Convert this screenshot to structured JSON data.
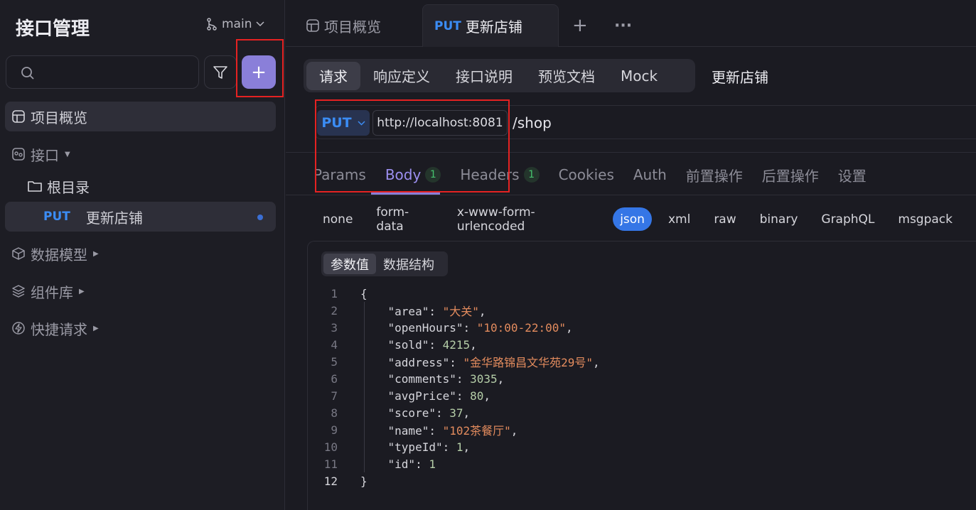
{
  "sidebar": {
    "title": "接口管理",
    "branch": "main",
    "add_label": "+",
    "overview": "项目概览",
    "interfaces": "接口",
    "root_dir": "根目录",
    "endpoint_method": "PUT",
    "endpoint_name": "更新店铺",
    "data_models": "数据模型",
    "components": "组件库",
    "quick_requests": "快捷请求"
  },
  "tabs": {
    "overview": "项目概览",
    "active_method": "PUT",
    "active_name": "更新店铺",
    "add": "+",
    "more": "···"
  },
  "subtabs": [
    "请求",
    "响应定义",
    "接口说明",
    "预览文档",
    "Mock"
  ],
  "api_name": "更新店铺",
  "url": {
    "method": "PUT",
    "base": "http://localhost:8081",
    "path": "/shop"
  },
  "request_tabs": {
    "params": "Params",
    "body": "Body",
    "body_count": "1",
    "headers": "Headers",
    "headers_count": "1",
    "cookies": "Cookies",
    "auth": "Auth",
    "pre": "前置操作",
    "post": "后置操作",
    "settings": "设置"
  },
  "body_types": [
    "none",
    "form-data",
    "x-www-form-urlencoded",
    "json",
    "xml",
    "raw",
    "binary",
    "GraphQL",
    "msgpack"
  ],
  "body_types_active": "json",
  "view_switch": [
    "参数值",
    "数据结构"
  ],
  "code": {
    "open": "{",
    "close": "}",
    "fields": [
      {
        "key": "\"area\"",
        "value": "\"大关\"",
        "type": "s"
      },
      {
        "key": "\"openHours\"",
        "value": "\"10:00-22:00\"",
        "type": "s"
      },
      {
        "key": "\"sold\"",
        "value": "4215",
        "type": "n"
      },
      {
        "key": "\"address\"",
        "value": "\"金华路锦昌文华苑29号\"",
        "type": "s"
      },
      {
        "key": "\"comments\"",
        "value": "3035",
        "type": "n"
      },
      {
        "key": "\"avgPrice\"",
        "value": "80",
        "type": "n"
      },
      {
        "key": "\"score\"",
        "value": "37",
        "type": "n"
      },
      {
        "key": "\"name\"",
        "value": "\"102茶餐厅\"",
        "type": "s"
      },
      {
        "key": "\"typeId\"",
        "value": "1",
        "type": "n"
      },
      {
        "key": "\"id\"",
        "value": "1",
        "type": "n"
      }
    ],
    "line_numbers": [
      "1",
      "2",
      "3",
      "4",
      "5",
      "6",
      "7",
      "8",
      "9",
      "10",
      "11",
      "12"
    ]
  },
  "colors": {
    "accent": "#8a7fd9",
    "put": "#3b8cf4",
    "highlight": "#e52222"
  }
}
